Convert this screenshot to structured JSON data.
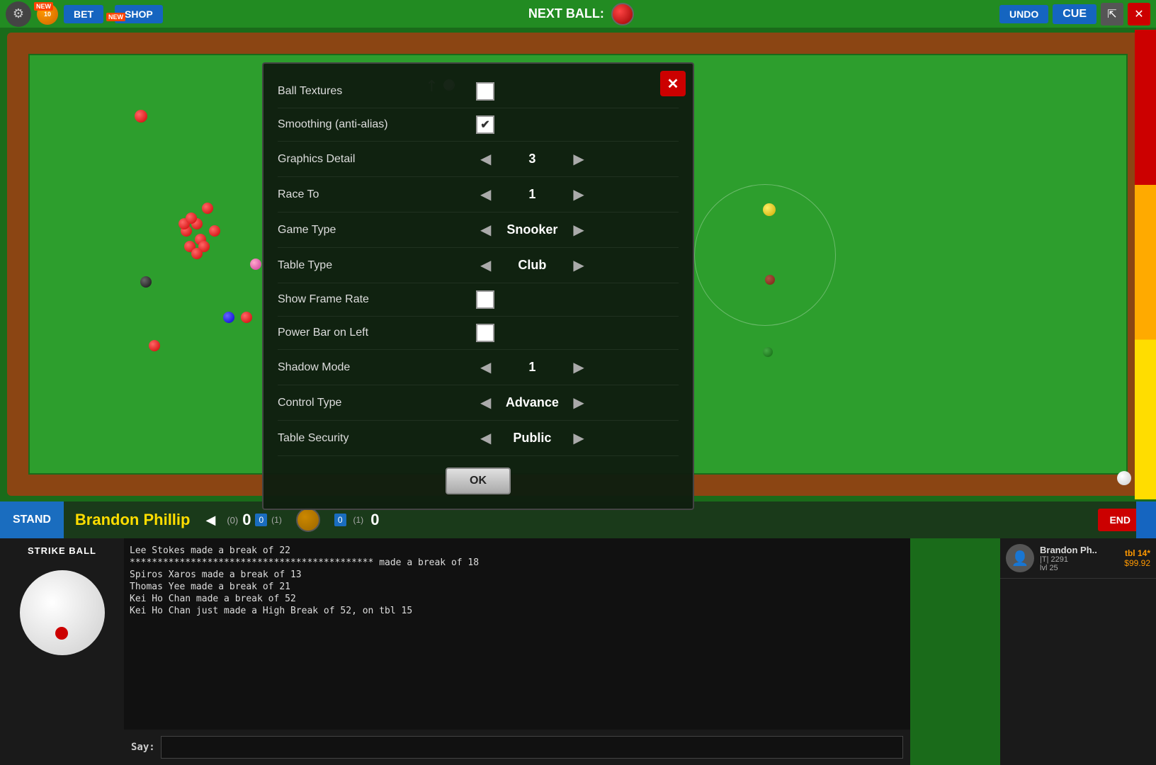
{
  "topbar": {
    "bet_label": "BET",
    "shop_label": "SHOP",
    "coins": "10",
    "next_ball_label": "NEXT BALL:",
    "undo_label": "UNDO",
    "cue_label": "CUE"
  },
  "settings": {
    "title": "Settings",
    "close_label": "✕",
    "rows": [
      {
        "label": "Ball Textures",
        "control_type": "checkbox",
        "checked": false,
        "value": ""
      },
      {
        "label": "Smoothing (anti-alias)",
        "control_type": "checkbox",
        "checked": true,
        "value": ""
      },
      {
        "label": "Graphics Detail",
        "control_type": "number",
        "value": "3"
      },
      {
        "label": "Race To",
        "control_type": "number",
        "value": "1"
      },
      {
        "label": "Game Type",
        "control_type": "select",
        "value": "Snooker"
      },
      {
        "label": "Table Type",
        "control_type": "select",
        "value": "Club"
      },
      {
        "label": "Show Frame Rate",
        "control_type": "checkbox",
        "checked": false,
        "value": ""
      },
      {
        "label": "Power Bar on Left",
        "control_type": "checkbox",
        "checked": false,
        "value": ""
      },
      {
        "label": "Shadow Mode",
        "control_type": "number",
        "value": "1"
      },
      {
        "label": "Control Type",
        "control_type": "select",
        "value": "Advance"
      },
      {
        "label": "Table Security",
        "control_type": "select",
        "value": "Public"
      }
    ],
    "ok_label": "OK"
  },
  "bottombar": {
    "stand_label": "STAND",
    "player_name": "Brandon  Phillip",
    "score_left": "0",
    "score_right": "0",
    "frames_left": "(0)",
    "frames_right": "(1)",
    "badge_left": "0",
    "badge_right": "0",
    "badge_label_left": "(1)",
    "end_label": "END"
  },
  "chat": {
    "messages": [
      "Lee Stokes made a break of 22",
      "******************************************** made a break of 18",
      "Spiros Xaros made a break of 13",
      "Thomas Yee made a break of 21",
      "Kei Ho Chan made a break of 52",
      "Kei Ho Chan just made a High Break of 52, on tbl 15"
    ],
    "say_label": "Say:",
    "input_placeholder": ""
  },
  "strike_ball": {
    "label": "STRIKE BALL"
  },
  "player_card": {
    "name": "Brandon Ph..",
    "tbl": "tbl 14*",
    "tier": "|T| 2291",
    "level": "lvl 25",
    "money": "$99.92"
  }
}
